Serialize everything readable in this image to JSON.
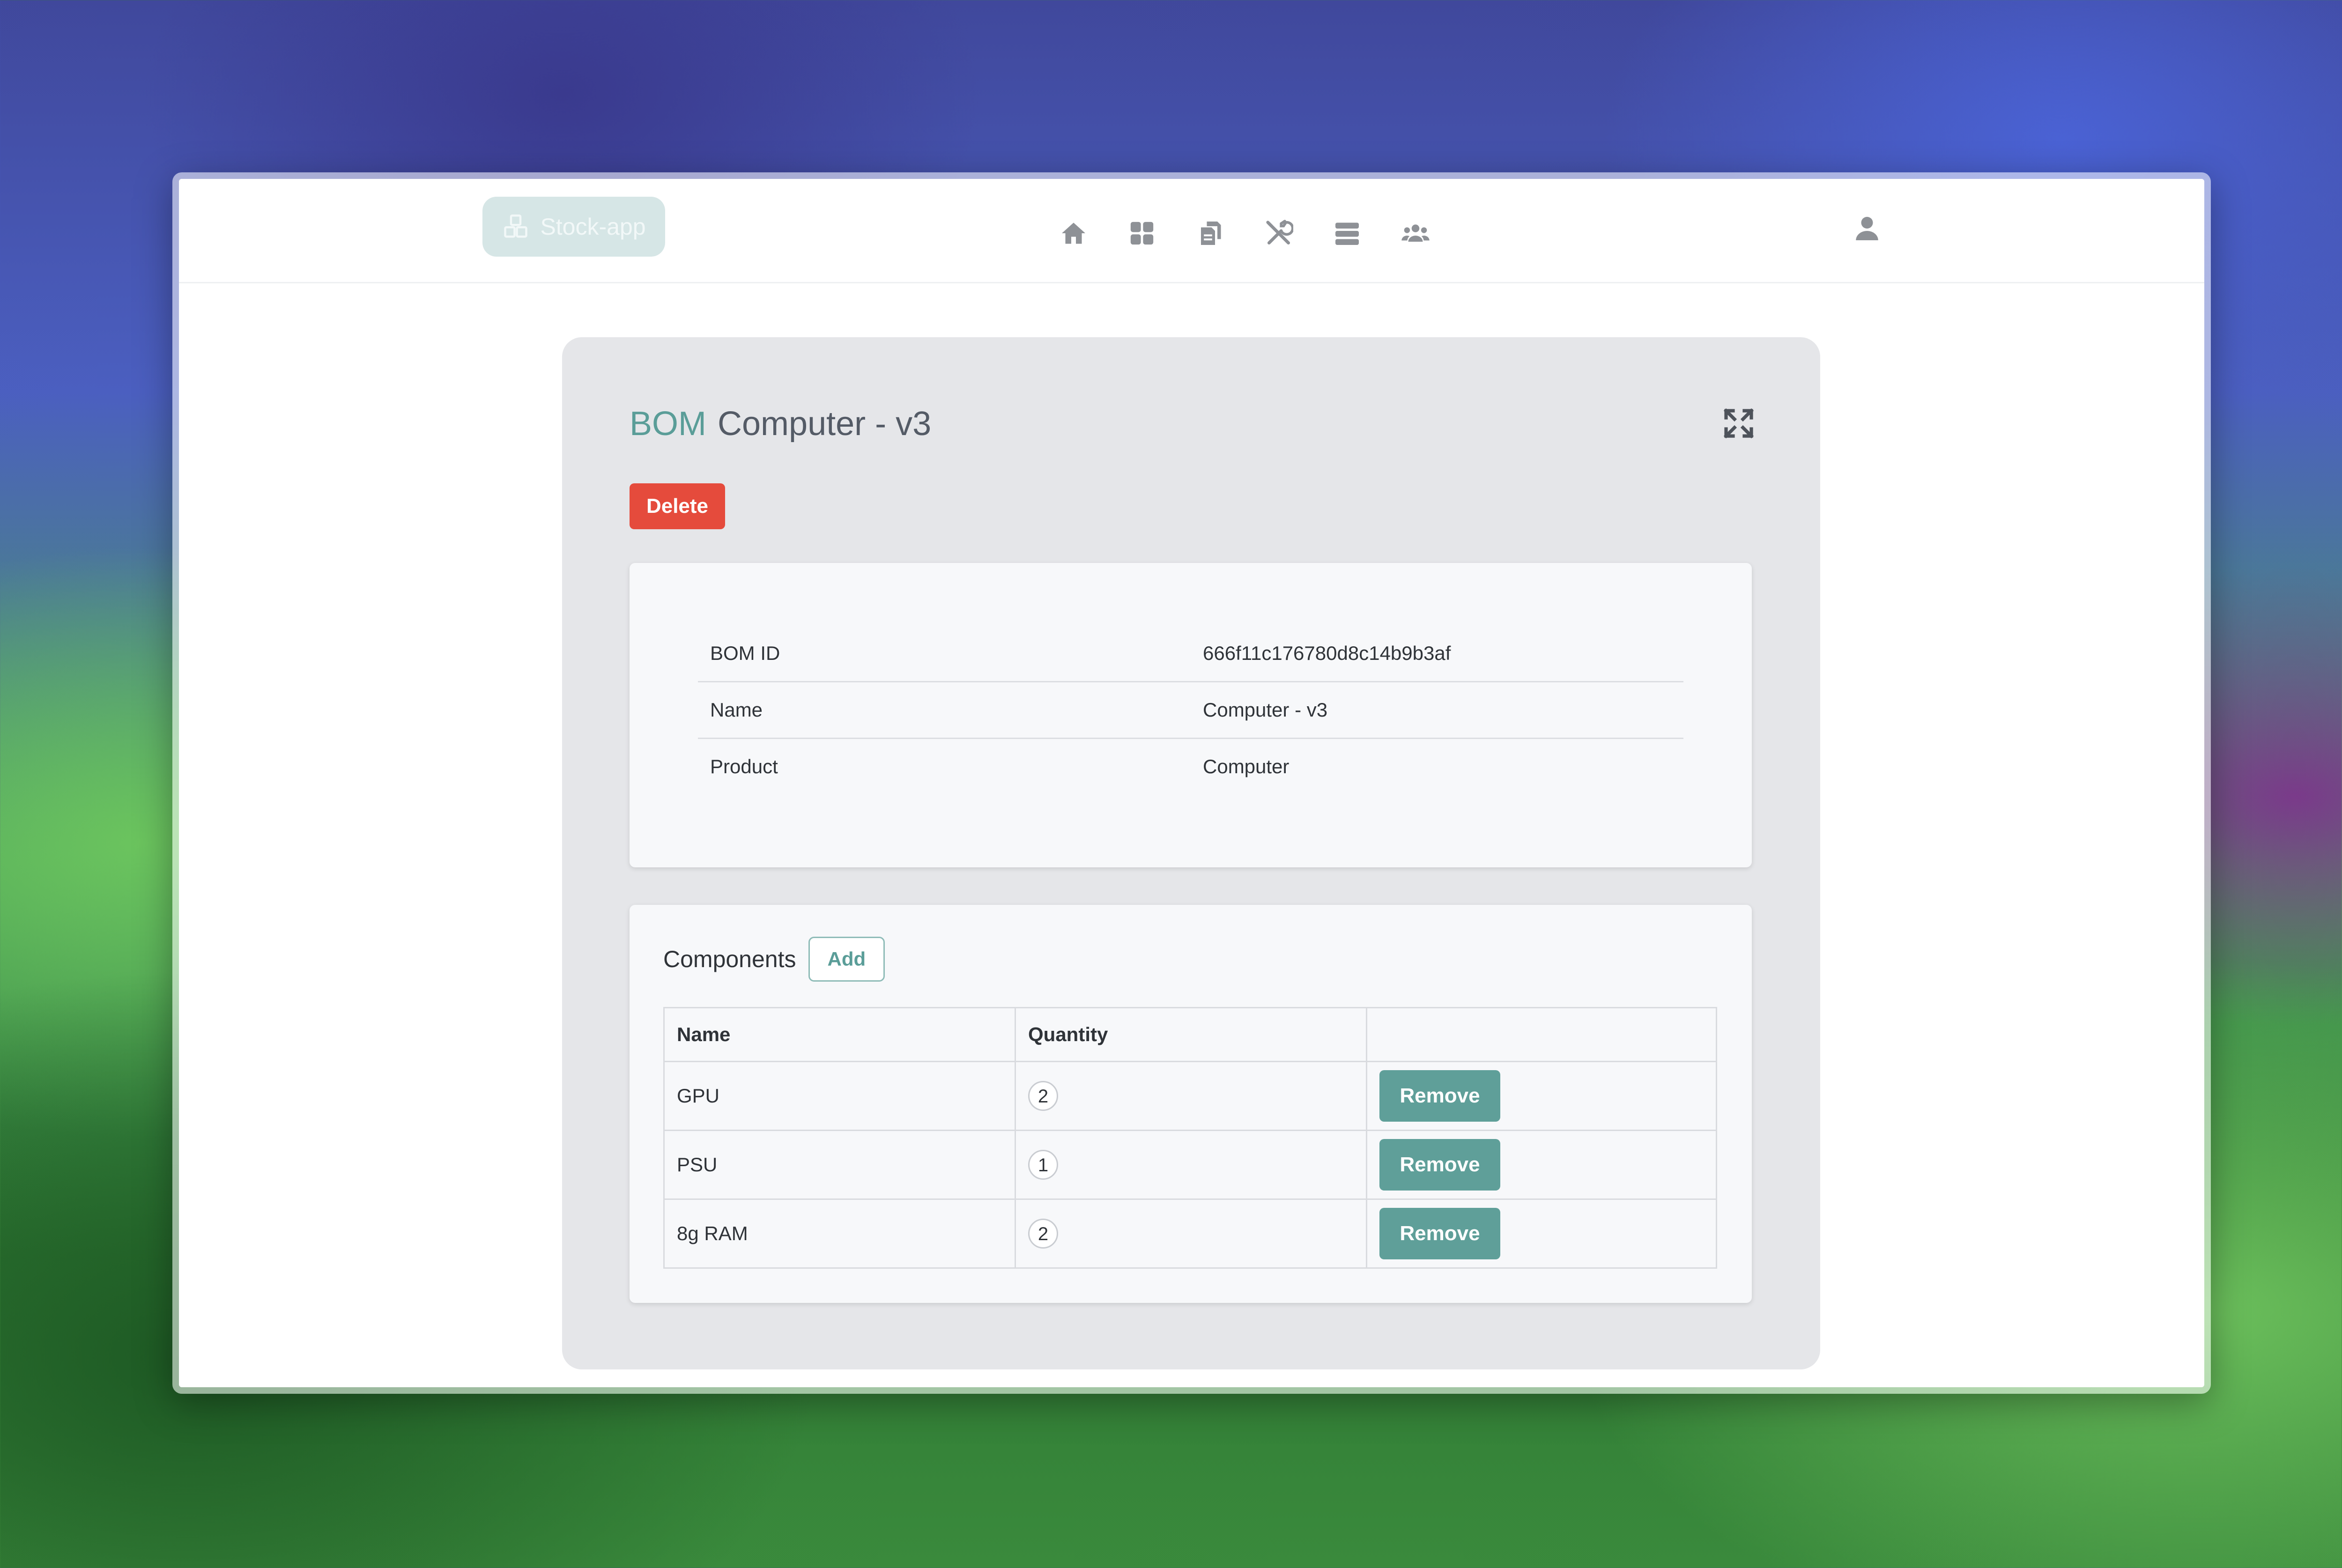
{
  "brand": {
    "name": "Stock-app",
    "icon": "boxes-icon"
  },
  "nav": [
    {
      "icon": "home-icon"
    },
    {
      "icon": "grid-icon"
    },
    {
      "icon": "documents-icon"
    },
    {
      "icon": "tools-icon"
    },
    {
      "icon": "server-icon"
    },
    {
      "icon": "users-icon"
    }
  ],
  "user": {
    "icon": "user-icon"
  },
  "page": {
    "prefix": "BOM",
    "title": "Computer - v3",
    "delete_label": "Delete"
  },
  "details": [
    {
      "key": "BOM ID",
      "value": "666f11c176780d8c14b9b3af"
    },
    {
      "key": "Name",
      "value": "Computer - v3"
    },
    {
      "key": "Product",
      "value": "Computer"
    }
  ],
  "components": {
    "title": "Components",
    "add_label": "Add",
    "headers": [
      "Name",
      "Quantity",
      ""
    ],
    "rows": [
      {
        "name": "GPU",
        "quantity": "2",
        "action": "Remove"
      },
      {
        "name": "PSU",
        "quantity": "1",
        "action": "Remove"
      },
      {
        "name": "8g RAM",
        "quantity": "2",
        "action": "Remove"
      }
    ]
  },
  "colors": {
    "accent": "#5f9f99",
    "danger": "#e54b3c",
    "panel": "#e5e6e9",
    "card": "#f7f8fa"
  }
}
